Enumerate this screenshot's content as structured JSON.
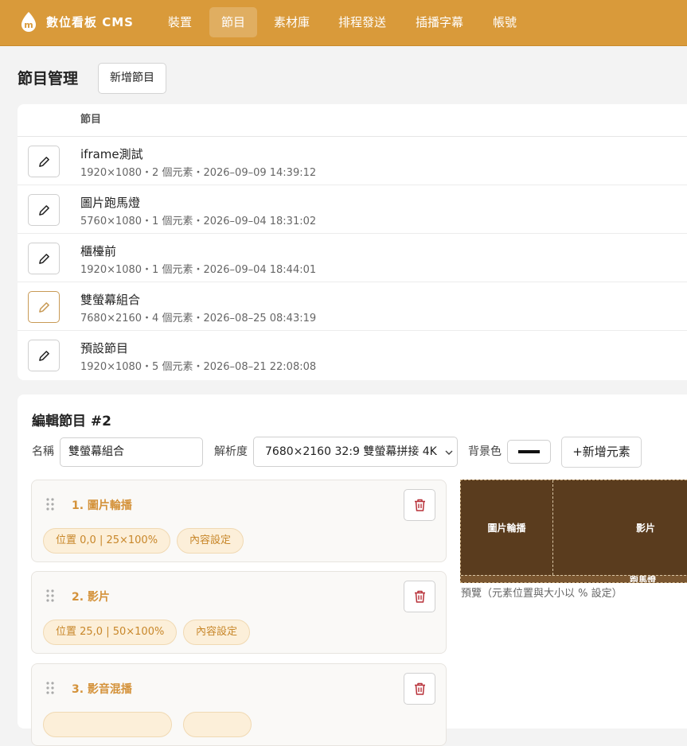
{
  "header": {
    "brand": "數位看板 CMS",
    "nav": [
      "裝置",
      "節目",
      "素材庫",
      "排程發送",
      "插播字幕",
      "帳號"
    ]
  },
  "programs": {
    "title": "節目管理",
    "add_label": "新增節目",
    "column": "節目",
    "rows": [
      {
        "name": "iframe測試",
        "meta": "1920×1080・2 個元素・2026–09–09 14:39:12"
      },
      {
        "name": "圖片跑馬燈",
        "meta": "5760×1080・1 個元素・2026–09–04 18:31:02"
      },
      {
        "name": "櫃檯前",
        "meta": "1920×1080・1 個元素・2026–09–04 18:44:01"
      },
      {
        "name": "雙螢幕組合",
        "meta": "7680×2160・4 個元素・2026–08–25 08:43:19"
      },
      {
        "name": "預設節目",
        "meta": "1920×1080・5 個元素・2026–08–21 22:08:08"
      }
    ]
  },
  "editor": {
    "title": "編輯節目 #2",
    "name_label": "名稱",
    "name_value": "雙螢幕組合",
    "resolution_label": "解析度",
    "resolution_value": "7680×2160 32:9 雙螢幕拼接 4K",
    "bg_label": "背景色",
    "bg_color": "#111111",
    "add_element_label": "+新增元素",
    "elements": [
      {
        "title": "1. 圖片輪播",
        "position": "位置 0,0 | 25×100%",
        "content": "內容設定"
      },
      {
        "title": "2. 影片",
        "position": "位置 25,0 | 50×100%",
        "content": "內容設定"
      },
      {
        "title": "3. 影音混播",
        "position": "",
        "content": ""
      }
    ],
    "preview": {
      "blocks": [
        "圖片輪播",
        "影片"
      ],
      "bottom_label": "跑馬燈",
      "caption": "預覽（元素位置與大小以 % 設定）"
    }
  },
  "colors": {
    "accent": "#d99a3a",
    "preview_bg": "#5a3c1e"
  }
}
